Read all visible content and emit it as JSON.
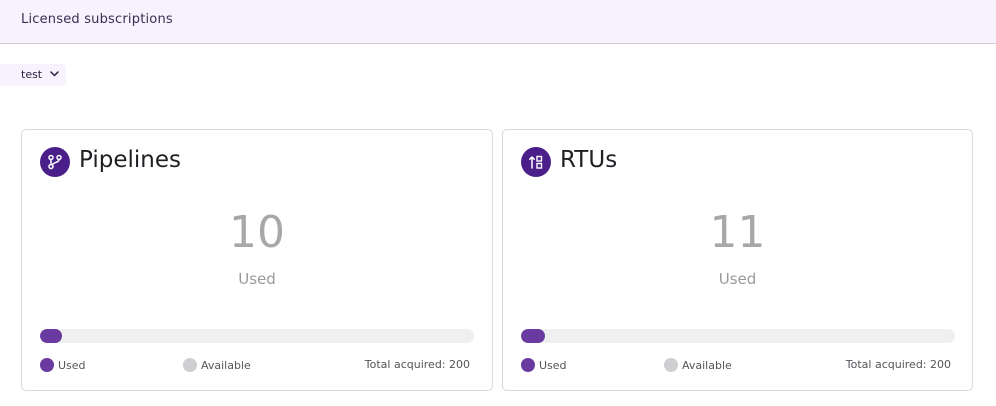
{
  "header": {
    "title": "Licensed subscriptions"
  },
  "environment": {
    "selected": "test",
    "icon": "chevron-down-icon"
  },
  "colors": {
    "accent": "#6a3aa1",
    "icon_bg": "#4a1f8a",
    "available": "#cfcfd2",
    "header_bg": "#f7f2fd"
  },
  "cards": [
    {
      "title": "Pipelines",
      "icon": "pipeline-icon",
      "used": "10",
      "used_label": "Used",
      "used_fraction": 0.05,
      "legend": {
        "used": "Used",
        "available": "Available",
        "total": "Total acquired: 200"
      }
    },
    {
      "title": "RTUs",
      "icon": "rtu-icon",
      "used": "11",
      "used_label": "Used",
      "used_fraction": 0.055,
      "legend": {
        "used": "Used",
        "available": "Available",
        "total": "Total acquired: 200"
      }
    }
  ]
}
